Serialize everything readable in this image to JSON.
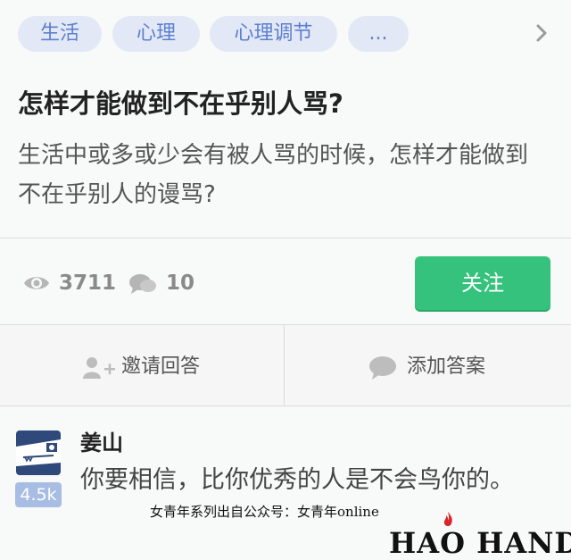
{
  "tags": [
    "生活",
    "心理",
    "心理调节",
    "..."
  ],
  "question": {
    "title": "怎样才能做到不在乎别人骂?",
    "description": "生活中或多或少会有被人骂的时候，怎样才能做到不在乎别人的谩骂?"
  },
  "stats": {
    "views": "3711",
    "comments": "10",
    "follow_label": "关注"
  },
  "actions": {
    "invite_label": "邀请回答",
    "add_answer_label": "添加答案"
  },
  "answer": {
    "author": "姜山",
    "votes": "4.5k",
    "text": "你要相信，比你优秀的人是不会鸟你的。"
  },
  "watermark": "女青年系列出自公众号：女青年online",
  "brand": "HAO HAND",
  "icons": [
    "chevron-right-icon",
    "eye-icon",
    "comment-icon",
    "add-user-icon",
    "speech-bubble-icon",
    "flame-icon"
  ],
  "colors": {
    "accent_green": "#34c27c",
    "tag_text": "#5d7fcf",
    "tag_bg": "#e2e8f5",
    "votes_bg": "#a7bde3"
  }
}
